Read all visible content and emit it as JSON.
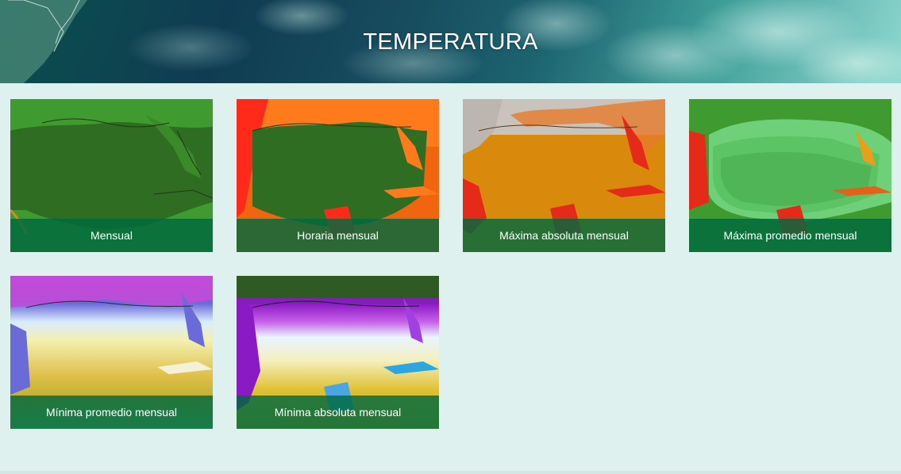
{
  "page": {
    "title": "TEMPERATURA"
  },
  "cards": [
    {
      "label": "Mensual"
    },
    {
      "label": "Horaria mensual"
    },
    {
      "label": "Máxima absoluta mensual"
    },
    {
      "label": "Máxima promedio mensual"
    },
    {
      "label": "Mínima promedio mensual"
    },
    {
      "label": "Mínima absoluta mensual"
    }
  ],
  "colors": {
    "page_background": "#dff1ef",
    "caption_overlay": "#00693e",
    "caption_text": "#ffffff"
  }
}
